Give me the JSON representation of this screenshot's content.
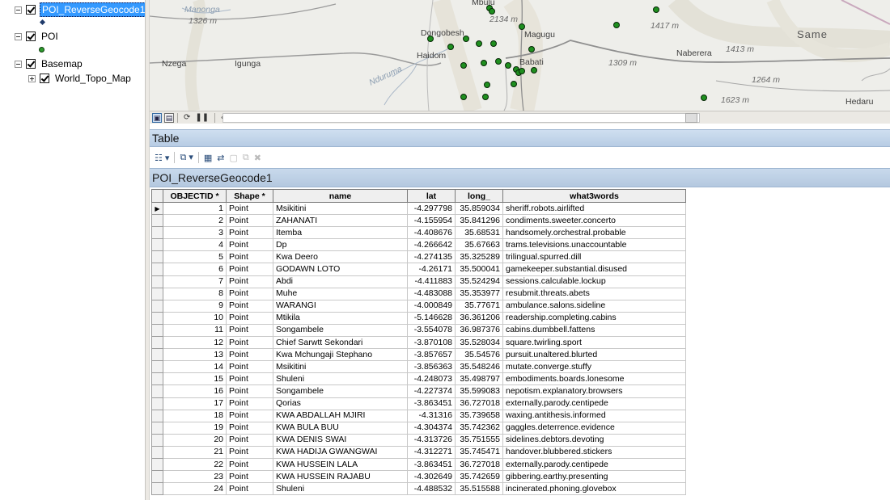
{
  "toc": {
    "layers": [
      {
        "label": "POI_ReverseGeocode1",
        "selected": true
      },
      {
        "label": "POI",
        "selected": false
      },
      {
        "label": "Basemap",
        "selected": false
      },
      {
        "label": "World_Topo_Map",
        "selected": false
      }
    ]
  },
  "map": {
    "places": [
      "Mbulu",
      "Manonga",
      "Dongobesh",
      "Magugu",
      "Haidom",
      "Babati",
      "Nzega",
      "Igunga",
      "Same",
      "Naberera",
      "Hedaru"
    ],
    "water": "Nduruma",
    "elevations": [
      "1326 m",
      "2134 m",
      "1417 m",
      "1309 m",
      "1413 m",
      "1264 m",
      "1623 m"
    ]
  },
  "table_window": {
    "title": "Table",
    "tab_label": "POI_ReverseGeocode1"
  },
  "table": {
    "columns": [
      "OBJECTID *",
      "Shape *",
      "name",
      "lat",
      "long_",
      "what3words"
    ],
    "rows": [
      [
        "1",
        "Point",
        "Msikitini",
        "-4.297798",
        "35.859034",
        "sheriff.robots.airlifted"
      ],
      [
        "2",
        "Point",
        "ZAHANATI",
        "-4.155954",
        "35.841296",
        "condiments.sweeter.concerto"
      ],
      [
        "3",
        "Point",
        "Itemba",
        "-4.408676",
        "35.68531",
        "handsomely.orchestral.probable"
      ],
      [
        "4",
        "Point",
        "Dp",
        "-4.266642",
        "35.67663",
        "trams.televisions.unaccountable"
      ],
      [
        "5",
        "Point",
        "Kwa Deero",
        "-4.274135",
        "35.325289",
        "trilingual.spurred.dill"
      ],
      [
        "6",
        "Point",
        "GODAWN LOTO",
        "-4.26171",
        "35.500041",
        "gamekeeper.substantial.disused"
      ],
      [
        "7",
        "Point",
        "Abdi",
        "-4.411883",
        "35.524294",
        "sessions.calculable.lockup"
      ],
      [
        "8",
        "Point",
        "Muhe",
        "-4.483088",
        "35.353977",
        "resubmit.threats.abets"
      ],
      [
        "9",
        "Point",
        "WARANGI",
        "-4.000849",
        "35.77671",
        "ambulance.salons.sideline"
      ],
      [
        "10",
        "Point",
        "Mtikila",
        "-5.146628",
        "36.361206",
        "readership.completing.cabins"
      ],
      [
        "11",
        "Point",
        "Songambele",
        "-3.554078",
        "36.987376",
        "cabins.dumbbell.fattens"
      ],
      [
        "12",
        "Point",
        "Chief Sarwtt Sekondari",
        "-3.870108",
        "35.528034",
        "square.twirling.sport"
      ],
      [
        "13",
        "Point",
        "Kwa Mchungaji Stephano",
        "-3.857657",
        "35.54576",
        "pursuit.unaltered.blurted"
      ],
      [
        "14",
        "Point",
        "Msikitini",
        "-3.856363",
        "35.548246",
        "mutate.converge.stuffy"
      ],
      [
        "15",
        "Point",
        "Shuleni",
        "-4.248073",
        "35.498797",
        "embodiments.boards.lonesome"
      ],
      [
        "16",
        "Point",
        "Songambele",
        "-4.227374",
        "35.599083",
        "nepotism.explanatory.browsers"
      ],
      [
        "17",
        "Point",
        "Qorias",
        "-3.863451",
        "36.727018",
        "externally.parody.centipede"
      ],
      [
        "18",
        "Point",
        "KWA ABDALLAH MJIRI",
        "-4.31316",
        "35.739658",
        "waxing.antithesis.informed"
      ],
      [
        "19",
        "Point",
        "KWA BULA BUU",
        "-4.304374",
        "35.742362",
        "gaggles.deterrence.evidence"
      ],
      [
        "20",
        "Point",
        "KWA DENIS SWAI",
        "-4.313726",
        "35.751555",
        "sidelines.debtors.devoting"
      ],
      [
        "21",
        "Point",
        "KWA HADIJA GWANGWAI",
        "-4.312271",
        "35.745471",
        "handover.blubbered.stickers"
      ],
      [
        "22",
        "Point",
        "KWA HUSSEIN LALA",
        "-3.863451",
        "36.727018",
        "externally.parody.centipede"
      ],
      [
        "23",
        "Point",
        "KWA HUSSEIN RAJABU",
        "-4.302649",
        "35.742659",
        "gibbering.earthy.presenting"
      ],
      [
        "24",
        "Point",
        "Shuleni",
        "-4.488532",
        "35.515588",
        "incinerated.phoning.glovebox"
      ]
    ]
  }
}
